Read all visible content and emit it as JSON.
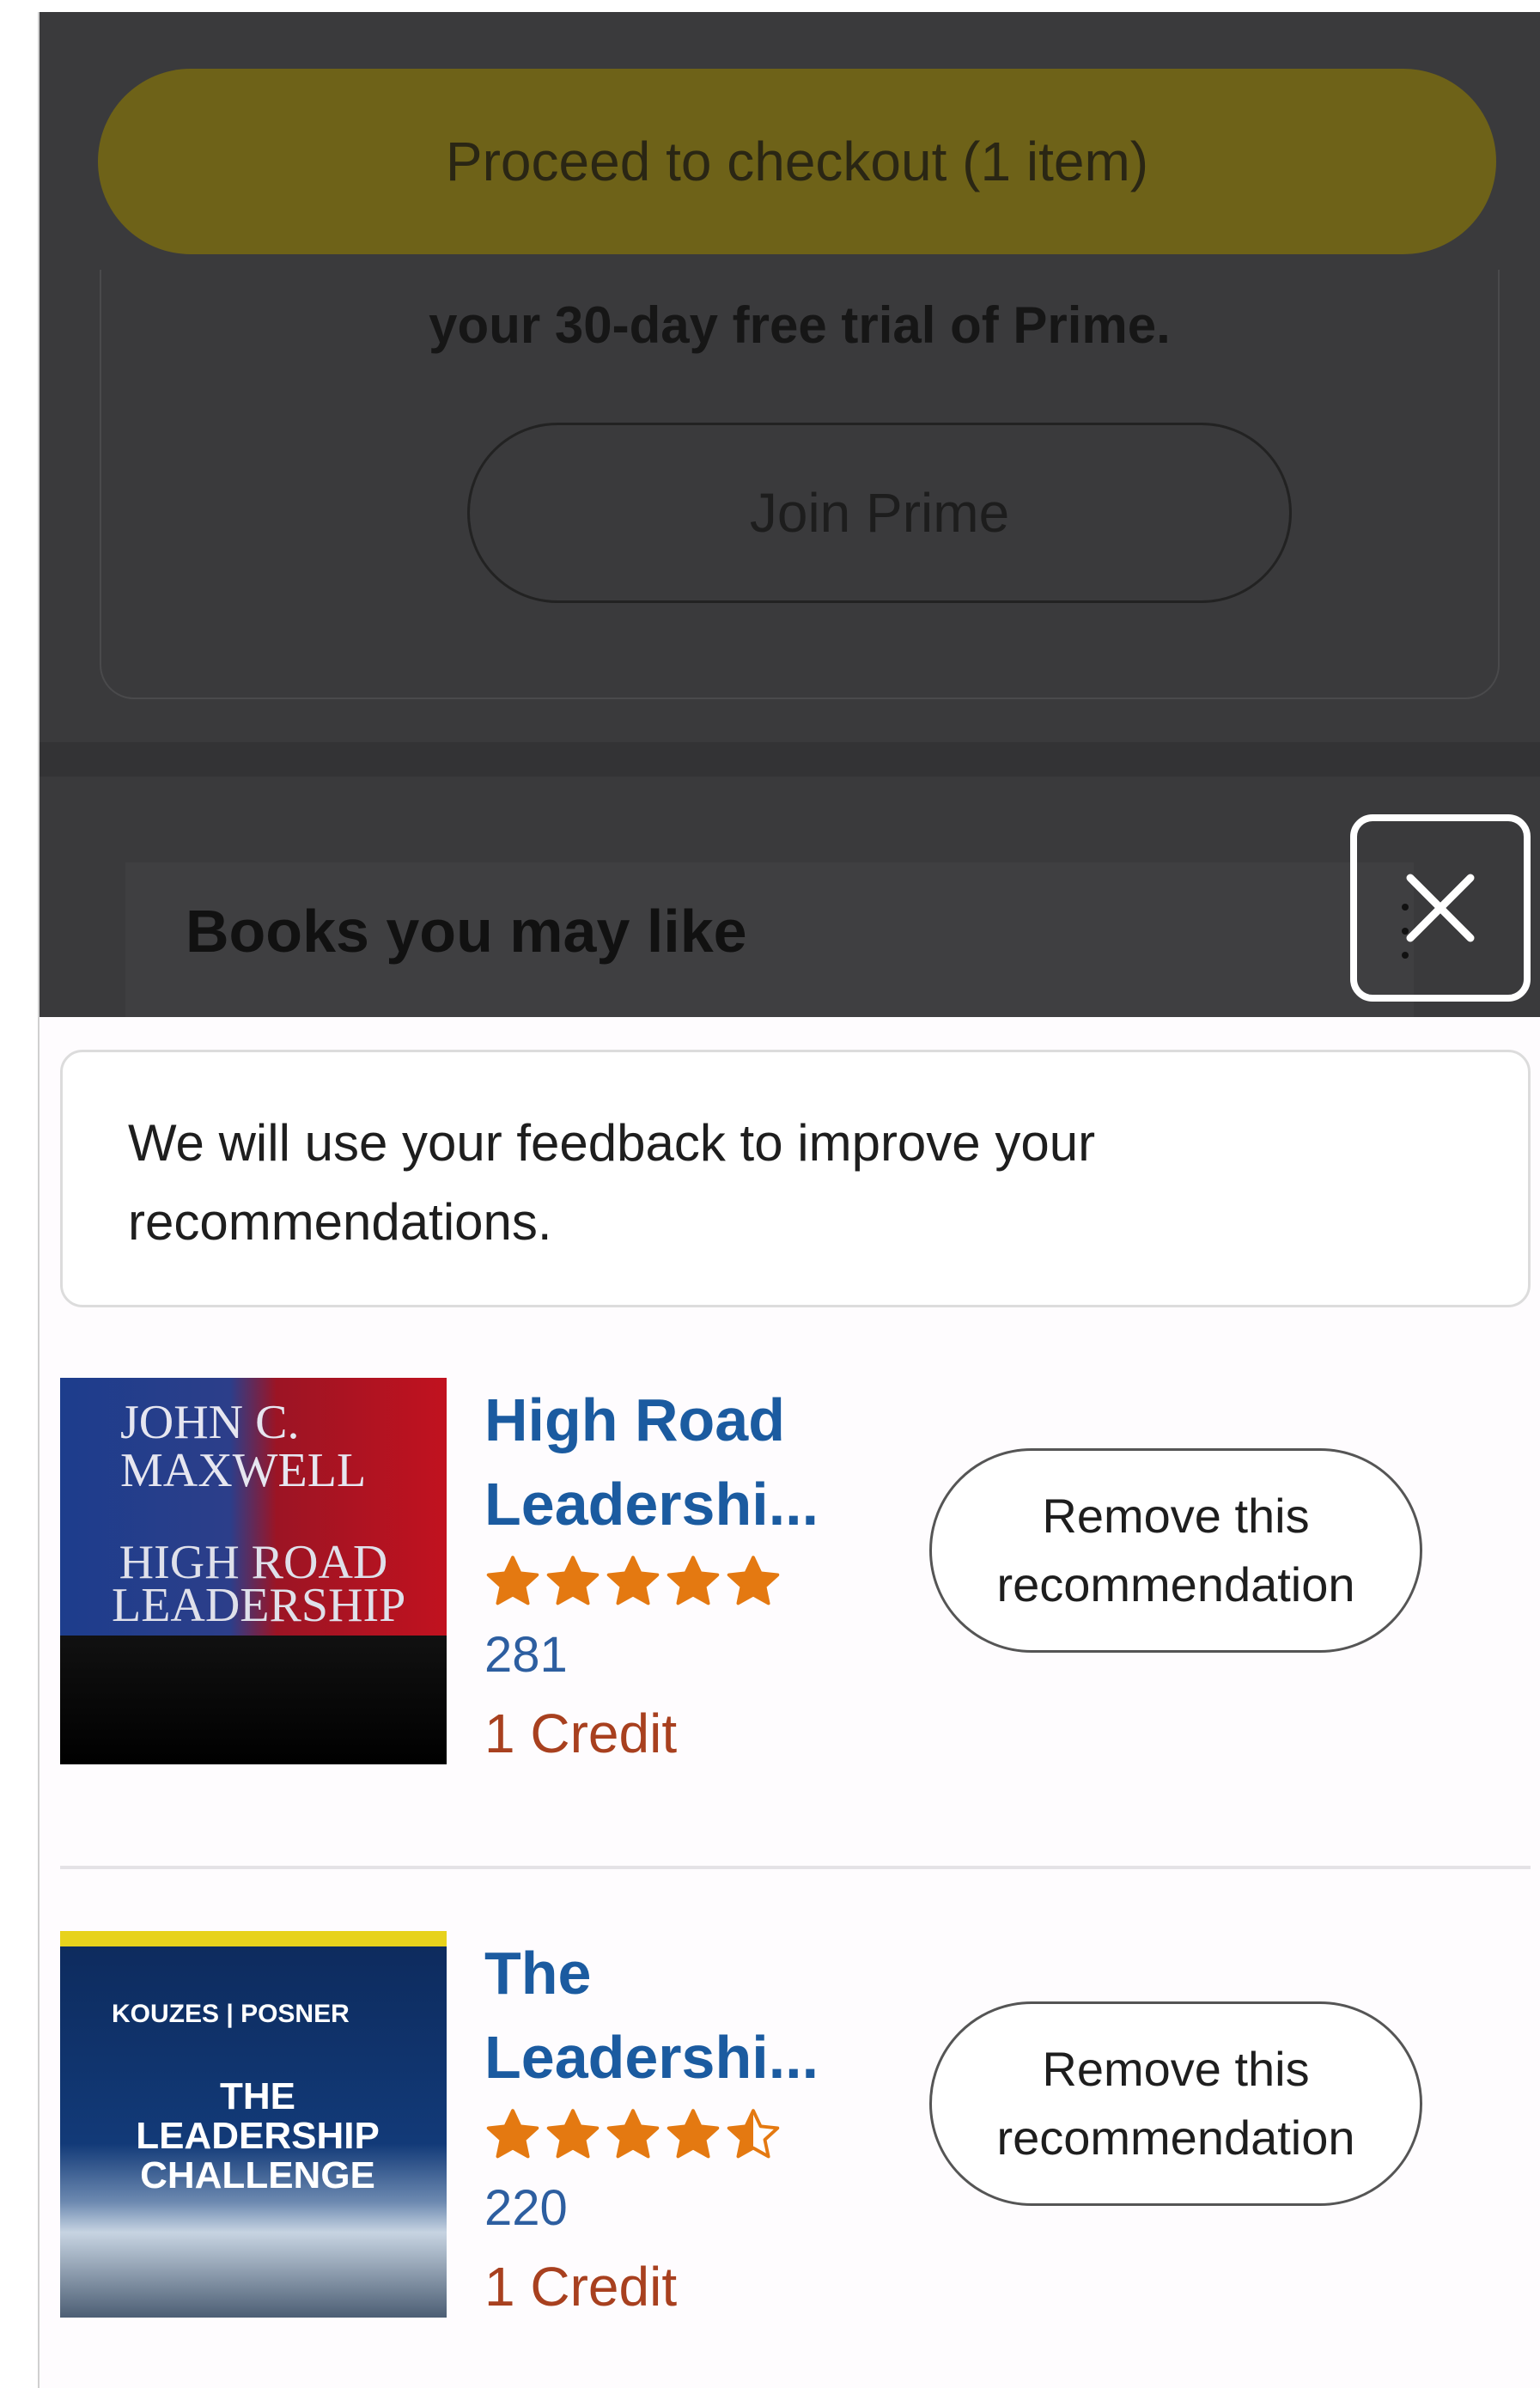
{
  "checkout": {
    "label": "Proceed to checkout (1 item)"
  },
  "prime": {
    "text": "your 30-day free trial of Prime.",
    "join_label": "Join Prime"
  },
  "section": {
    "title": "Books you may like"
  },
  "feedback": {
    "message": "We will use your feedback to improve your recommendations."
  },
  "recommendations": [
    {
      "title": "High Road\nLeadershi...",
      "cover_author": "JOHN C. MAXWELL",
      "cover_title": "HIGH ROAD LEADERSHIP",
      "rating_stars": 5,
      "rating_count": "281",
      "price": "1 Credit",
      "remove_label": "Remove this\nrecommendation"
    },
    {
      "title": "The\nLeadershi...",
      "cover_authors": "KOUZES | POSNER",
      "cover_title": "THE LEADERSHIP CHALLENGE",
      "rating_stars": 4.5,
      "rating_count": "220",
      "price": "1 Credit",
      "remove_label": "Remove this\nrecommendation"
    }
  ],
  "colors": {
    "star": "#e47911",
    "title_link": "#1b5ba0",
    "credit": "#a8401f"
  }
}
